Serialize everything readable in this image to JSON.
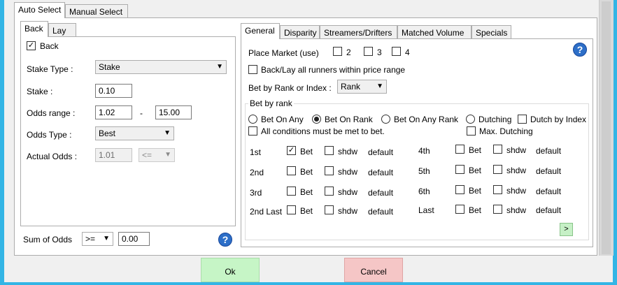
{
  "main_tabs": [
    "Auto Select",
    "Manual Select"
  ],
  "side_tabs": [
    "Back",
    "Lay"
  ],
  "back_panel": {
    "back_checkbox": "Back",
    "stake_type_label": "Stake Type :",
    "stake_type_value": "Stake",
    "stake_label": "Stake :",
    "stake_value": "0.10",
    "odds_range_label": "Odds range :",
    "odds_min": "1.02",
    "odds_dash": "-",
    "odds_max": "15.00",
    "odds_type_label": "Odds Type :",
    "odds_type_value": "Best",
    "actual_odds_label": "Actual Odds :",
    "actual_odds_value": "1.01",
    "actual_odds_op": "<="
  },
  "sum_of_odds": {
    "label": "Sum of Odds",
    "op": ">=",
    "value": "0.00"
  },
  "right_tabs": [
    "General",
    "Disparity",
    "Streamers/Drifters",
    "Matched Volume",
    "Specials"
  ],
  "general": {
    "place_market_label": "Place Market (use)",
    "place_options": [
      "2",
      "3",
      "4"
    ],
    "back_lay_all": "Back/Lay all runners within price range",
    "bet_by_rank_index_label": "Bet by Rank or Index :",
    "bet_by_rank_index_value": "Rank",
    "group_title": "Bet by rank",
    "radios": [
      "Bet On Any",
      "Bet On Rank",
      "Bet On Any Rank",
      "Dutching"
    ],
    "dutch_by_index": "Dutch by Index",
    "all_conditions": "All conditions must be met to bet.",
    "max_dutching": "Max. Dutching",
    "bet_label": "Bet",
    "shdw_label": "shdw",
    "default_label": "default",
    "ranks_left": [
      "1st",
      "2nd",
      "3rd",
      "2nd Last"
    ],
    "ranks_right": [
      "4th",
      "5th",
      "6th",
      "Last"
    ],
    "next_button": ">"
  },
  "buttons": {
    "ok": "Ok",
    "cancel": "Cancel"
  },
  "help_icon": "?",
  "colors": {
    "ok_bg": "#c6f5c6",
    "cancel_bg": "#f5c6c6",
    "help_bg": "#2d6fc8",
    "window_border": "#33b5e5"
  }
}
